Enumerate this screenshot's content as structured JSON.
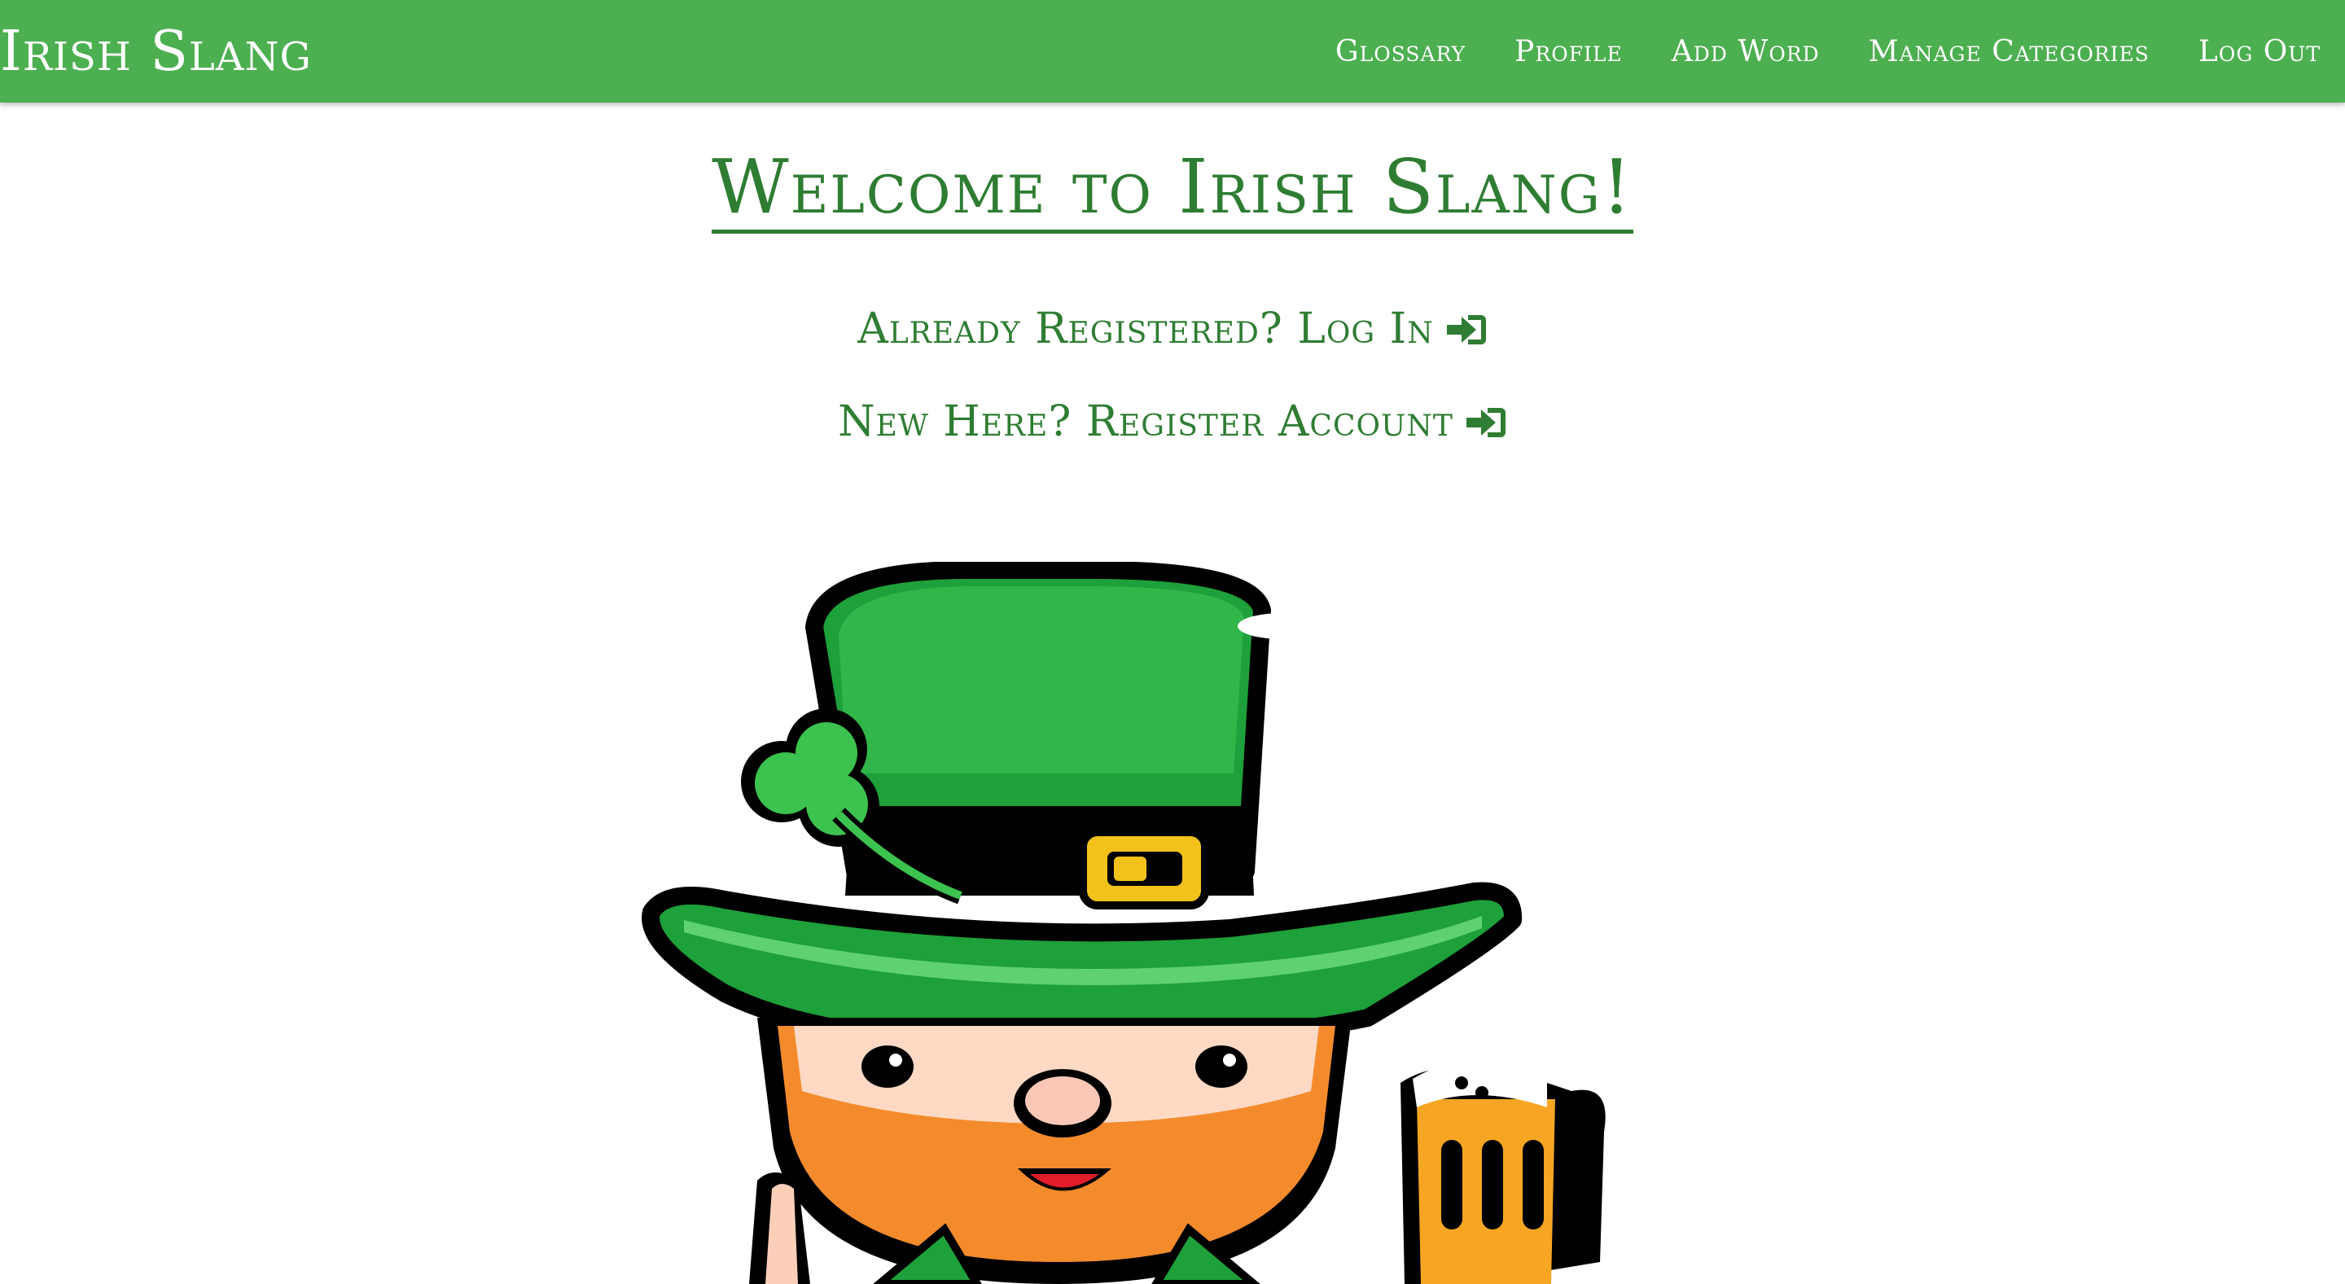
{
  "navbar": {
    "brand": "Irish Slang",
    "links": [
      {
        "label": "Glossary"
      },
      {
        "label": "Profile"
      },
      {
        "label": "Add Word"
      },
      {
        "label": "Manage Categories"
      },
      {
        "label": "Log Out"
      }
    ]
  },
  "main": {
    "heading": "Welcome to Irish Slang!",
    "login_text": "Already Registered? Log In",
    "register_text": "New Here? Register Account",
    "icons": {
      "auth": "sign-in-icon",
      "mascot": "leprechaun-illustration"
    }
  },
  "colors": {
    "navbar": "#4caf50",
    "text_green": "#2e7d32",
    "white": "#ffffff"
  }
}
